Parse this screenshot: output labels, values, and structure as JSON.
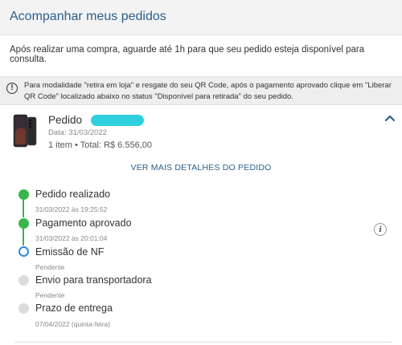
{
  "header": {
    "title": "Acompanhar meus pedidos"
  },
  "intro": {
    "text": "Após realizar uma compra, aguarde até 1h para que seu pedido esteja disponível para consulta."
  },
  "notice": {
    "icon": "alert-circle-icon",
    "text": "Para modalidade \"retira em loja\" e resgate do seu QR Code, após o pagamento aprovado clique em \"Liberar QR Code\" localizado abaixo no status \"Disponível para retirada\" do seu pedido."
  },
  "order": {
    "label": "Pedido",
    "date": "Data: 31/03/2022",
    "summary": "1 item • Total: R$ 6.556,00",
    "collapse_icon": "chevron-up-icon"
  },
  "details_link": "VER MAIS DETALHES DO PEDIDO",
  "timeline": [
    {
      "label": "Pedido realizado",
      "sub": "31/03/2022 às 19:25:52",
      "status": "done"
    },
    {
      "label": "Pagamento aprovado",
      "sub": "31/03/2022 às 20:01:04",
      "status": "done"
    },
    {
      "label": "Emissão de NF",
      "sub": "Pendente",
      "status": "current"
    },
    {
      "label": "Envio para transportadora",
      "sub": "Pendente",
      "status": "pending"
    },
    {
      "label": "Prazo de entrega",
      "sub": "07/04/2022 (quinta-feira)",
      "status": "pending"
    }
  ],
  "info_icon": {
    "glyph": "i",
    "name": "info-icon"
  },
  "colors": {
    "title_blue": "#2b5f8e",
    "step_done": "#39b54a",
    "step_current": "#2a8bd8",
    "step_pending": "#dcdcdc",
    "redaction": "#2ed0dd"
  }
}
